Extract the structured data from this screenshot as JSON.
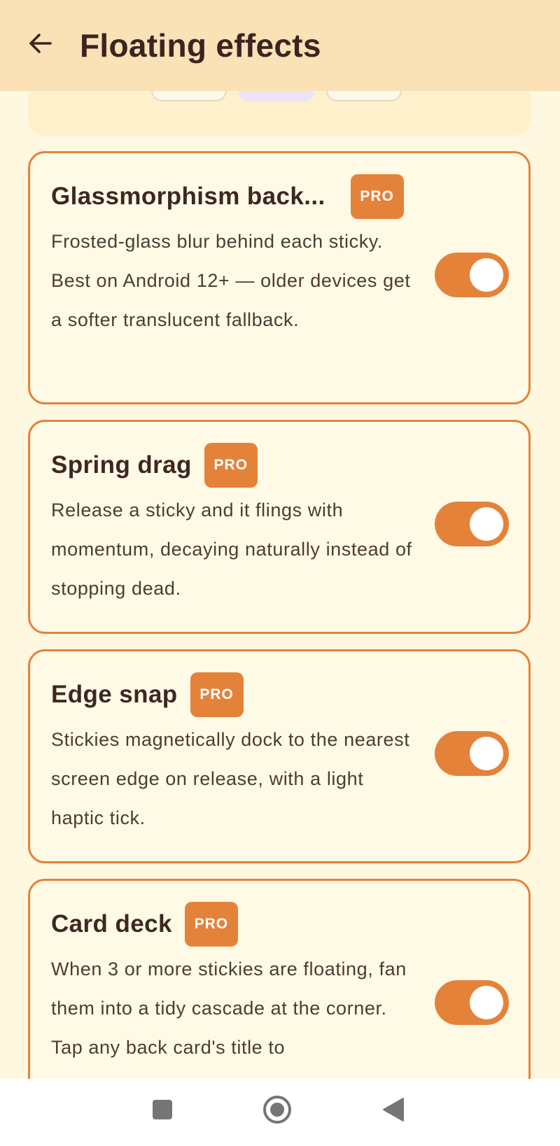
{
  "app_bar": {
    "title": "Floating effects",
    "back_icon": "arrow-left-icon",
    "background": "#FAE1B6"
  },
  "theme": {
    "accent": "#E5823A",
    "page_background": "#FFF8E1",
    "card_background": "#FFFAE6"
  },
  "settings": [
    {
      "title": "Glassmorphism back...",
      "badge": "PRO",
      "description": "Frosted-glass blur behind each sticky. Best on Android 12+ — older devices get a softer translucent fallback.",
      "enabled": true
    },
    {
      "title": "Spring drag",
      "badge": "PRO",
      "description": "Release a sticky and it flings with momentum, decaying naturally instead of stopping dead.",
      "enabled": true
    },
    {
      "title": "Edge snap",
      "badge": "PRO",
      "description": "Stickies magnetically dock to the nearest screen edge on release, with a light haptic tick.",
      "enabled": true
    },
    {
      "title": "Card deck",
      "badge": "PRO",
      "description": "When 3 or more stickies are floating, fan them into a tidy cascade at the corner. Tap any back card's title to",
      "enabled": true
    }
  ],
  "nav_bar": {
    "recents_icon": "square-icon",
    "home_icon": "circle-icon",
    "back_icon": "triangle-back-icon"
  }
}
